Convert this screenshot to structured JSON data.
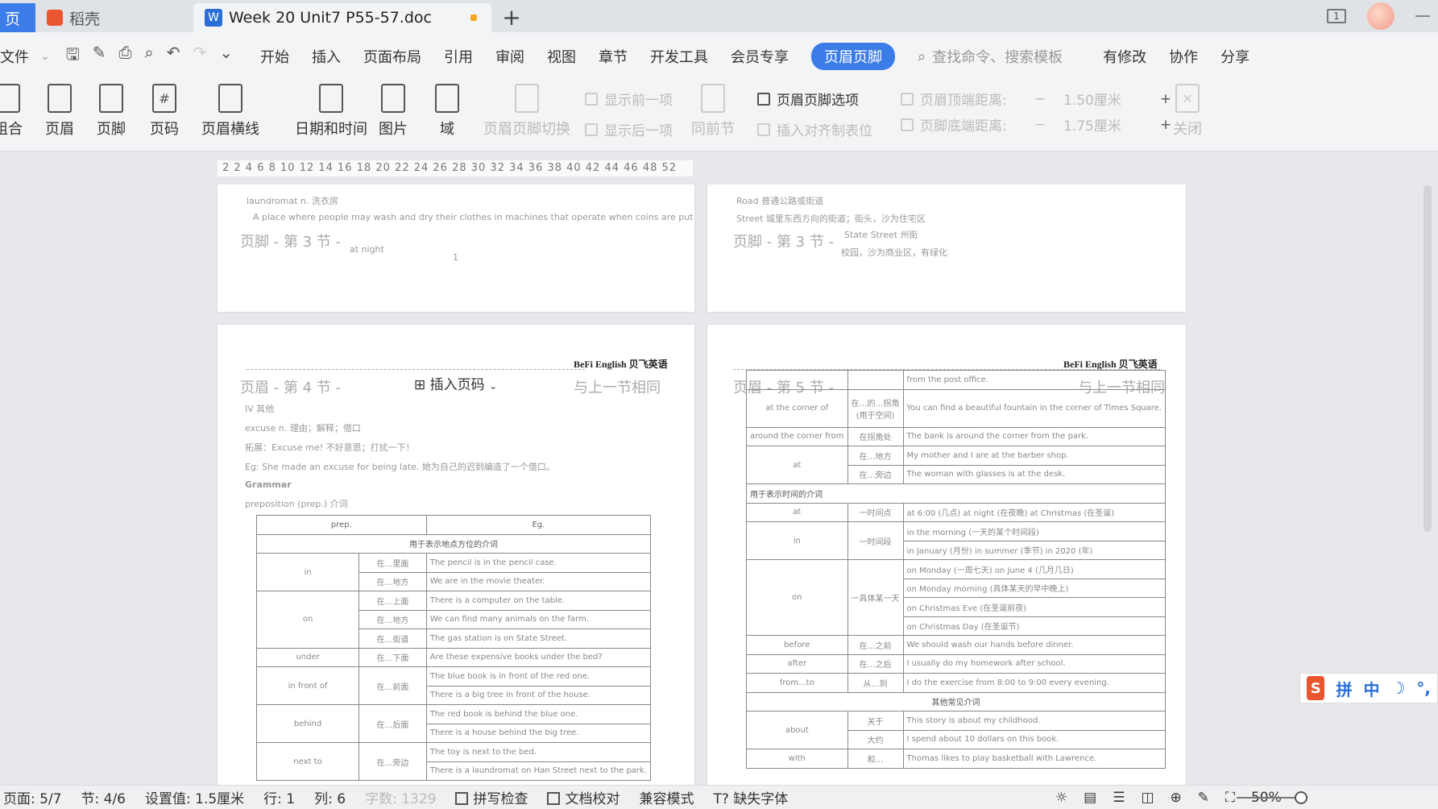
{
  "tabs": {
    "home": "页",
    "daoke": "稻壳",
    "doc": "Week 20 Unit7 P55-57.doc",
    "add": "+"
  },
  "menu": {
    "file": "文件",
    "items": [
      "开始",
      "插入",
      "页面布局",
      "引用",
      "审阅",
      "视图",
      "章节",
      "开发工具",
      "会员专享"
    ],
    "active": "页眉页脚",
    "search": "查找命令、搜索模板",
    "right": [
      "有修改",
      "协作",
      "分享"
    ]
  },
  "ribbon": {
    "buttons": [
      "组合",
      "页眉",
      "页脚",
      "页码",
      "页眉横线",
      "日期和时间",
      "图片",
      "域"
    ],
    "dim_buttons": [
      "页眉页脚切换",
      "同前节",
      "关闭"
    ],
    "options": {
      "prev": "显示前一项",
      "next": "显示后一项",
      "hf_options": "页眉页脚选项",
      "insert_align": "插入对齐制表位",
      "header_top": "页眉顶端距离:",
      "header_top_val": "1.50厘米",
      "footer_bottom": "页脚底端距离:",
      "footer_bottom_val": "1.75厘米"
    }
  },
  "ruler": "2  2  4  6  8  10  12  14  16  18  20  22  24  26  28  30  32  34  36  38  40  42  44  46  48  52",
  "pages": {
    "p1": {
      "footer": "页脚 - 第 3 节 -",
      "line1": "laundromat   n. 洗衣房",
      "line2": "A place where people may wash and dry their clothes in machines that operate when coins are put in them.",
      "line3": "at night",
      "num": "1"
    },
    "p2": {
      "footer": "页脚 - 第 3 节 -",
      "line1": "Road 普通公路或街道",
      "line2": "Street 城里东西方向的街道；街头，沙为住宅区",
      "line3": "State Street 州街",
      "line4": "校园，沙为商业区，有绿化"
    },
    "p3": {
      "header": "页眉 - 第 4 节 -",
      "brand": "BeFi English 贝飞英语",
      "insert": "插入页码",
      "same": "与上一节相同",
      "lines": [
        "IV 其他",
        "excuse   n. 理由；解释；借口",
        "拓展：Excuse me! 不好意思；打扰一下！",
        "Eg: She made an excuse for being late. 她为自己的迟到编造了一个借口。",
        "Grammar",
        "preposition (prep.) 介词"
      ],
      "table_head": [
        "prep.",
        "Eg."
      ],
      "section": "用于表示地点方位的介词",
      "rows": [
        [
          "in",
          "在…里面",
          "The pencil is in the pencil case."
        ],
        [
          "",
          "在…地方",
          "We are in the movie theater."
        ],
        [
          "on",
          "在…上面",
          "There is a computer on the table."
        ],
        [
          "",
          "在…地方",
          "We can find many animals on the farm."
        ],
        [
          "",
          "在…街道",
          "The gas station is on State Street."
        ],
        [
          "under",
          "在…下面",
          "Are these expensive books under the bed?"
        ],
        [
          "in front of",
          "在…前面",
          "The blue book is in front of the red one."
        ],
        [
          "",
          "",
          "There is a big tree in front of the house."
        ],
        [
          "behind",
          "在…后面",
          "The red book is behind the blue one."
        ],
        [
          "",
          "",
          "There is a house behind the big tree."
        ],
        [
          "next to",
          "在…旁边",
          "The toy is next to the bed."
        ],
        [
          "",
          "",
          "There is a laundromat on Han Street next to the park."
        ]
      ]
    },
    "p4": {
      "header": "页眉 - 第 5 节 -",
      "brand": "BeFi English 贝飞英语",
      "same": "与上一节相同",
      "rows_a": [
        [
          "",
          "",
          "from the post office."
        ],
        [
          "at the corner of",
          "在…的…拐角(用于空间)",
          "You can find a beautiful fountain in the corner of Times Square."
        ],
        [
          "around the corner from",
          "在拐角处",
          "The bank is around the corner from the park."
        ],
        [
          "at",
          "在…地方",
          "My mother and I are at the barber shop."
        ],
        [
          "",
          "在…旁边",
          "The woman with glasses is at the desk."
        ]
      ],
      "section_time": "用于表示时间的介词",
      "rows_b": [
        [
          "at",
          "一时间点",
          "at 6:00 (几点) at night (在夜晚) at Christmas (在圣诞)"
        ],
        [
          "in",
          "一时间段",
          "in the morning (一天的某个时间段)"
        ],
        [
          "",
          "",
          "in January (月份) in summer (季节) in 2020 (年)"
        ],
        [
          "on",
          "一具体某一天",
          "on Monday (一周七天) on June 4 (几月几日)"
        ],
        [
          "",
          "",
          "on Monday morning (具体某天的早中晚上)"
        ],
        [
          "",
          "",
          "on Christmas Eve (在圣诞前夜)"
        ],
        [
          "",
          "",
          "on Christmas Day (在圣诞节)"
        ],
        [
          "before",
          "在…之前",
          "We should wash our hands before dinner."
        ],
        [
          "after",
          "在…之后",
          "I usually do my homework after school."
        ],
        [
          "from...to",
          "从…到",
          "I do the exercise from 8:00 to 9:00 every evening."
        ]
      ],
      "section_other": "其他常见介词",
      "rows_c": [
        [
          "about",
          "关于",
          "This story is about my childhood."
        ],
        [
          "",
          "大约",
          "I spend about 10 dollars on this book."
        ],
        [
          "with",
          "和…",
          "Thomas likes to play basketball with Lawrence."
        ]
      ]
    }
  },
  "ime": [
    "拼",
    "中"
  ],
  "status": {
    "page": "页面: 5/7",
    "section": "节: 4/6",
    "setting": "设置值: 1.5厘米",
    "row": "行: 1",
    "col": "列: 6",
    "words": "字数: 1329",
    "spell": "拼写检查",
    "proof": "文档校对",
    "compat": "兼容模式",
    "font_missing": "缺失字体",
    "zoom": "50%"
  }
}
